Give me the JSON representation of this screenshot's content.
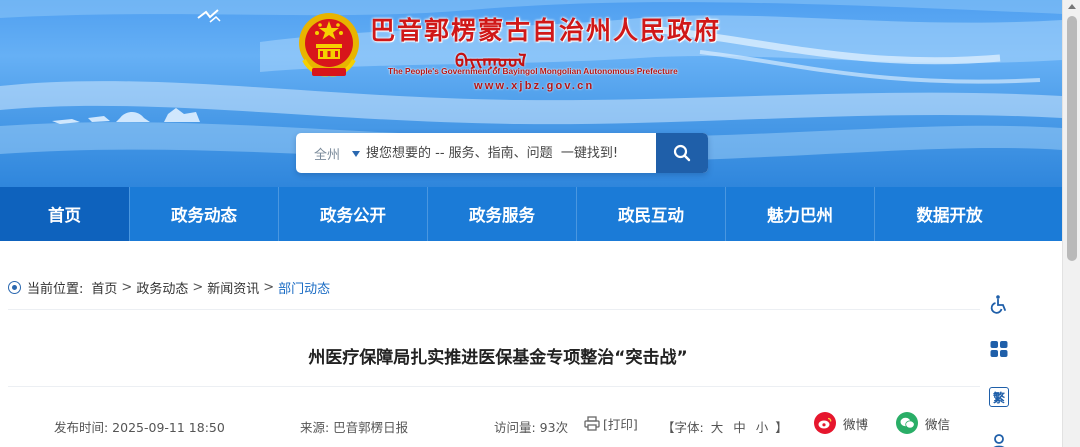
{
  "header": {
    "title": "巴音郭楞蒙古自治州人民政府",
    "mongolian": "ᠪᠠᠶᠢᠨᠭᠣᠤᠯ",
    "subtitle_en": "The People's Government of Bayingol Mongolian Autonomous Prefecture",
    "url": "www.xjbz.gov.cn"
  },
  "search": {
    "scope": "全州",
    "placeholder": "搜您想要的 -- 服务、指南、问题  一键找到!"
  },
  "nav": {
    "items": [
      "首页",
      "政务动态",
      "政务公开",
      "政务服务",
      "政民互动",
      "魅力巴州",
      "数据开放"
    ],
    "active": "政务动态"
  },
  "breadcrumb": {
    "label": "当前位置:",
    "items": [
      "首页",
      "政务动态",
      "新闻资讯",
      "部门动态"
    ],
    "separator": ">"
  },
  "article": {
    "title": "州医疗保障局扎实推进医保基金专项整治“突击战”",
    "publish_time": "发布时间:  2025-09-11 18:50",
    "source": "来源:  巴音郭楞日报",
    "views": "访问量:  93次",
    "print": "[打印]",
    "font_label": "【字体:",
    "font_large": "大",
    "font_medium": "中",
    "font_small": "小",
    "font_close": "】",
    "share_weibo": "微博",
    "share_wechat": "微信"
  },
  "tools": {
    "traditional": "繁"
  },
  "colors": {
    "nav_blue": "#1b7bd7",
    "nav_home": "#0e62bd",
    "title_red": "#d01818",
    "link_blue": "#1b6cc4",
    "weibo_red": "#e6162d",
    "wechat_green": "#2aae67"
  }
}
